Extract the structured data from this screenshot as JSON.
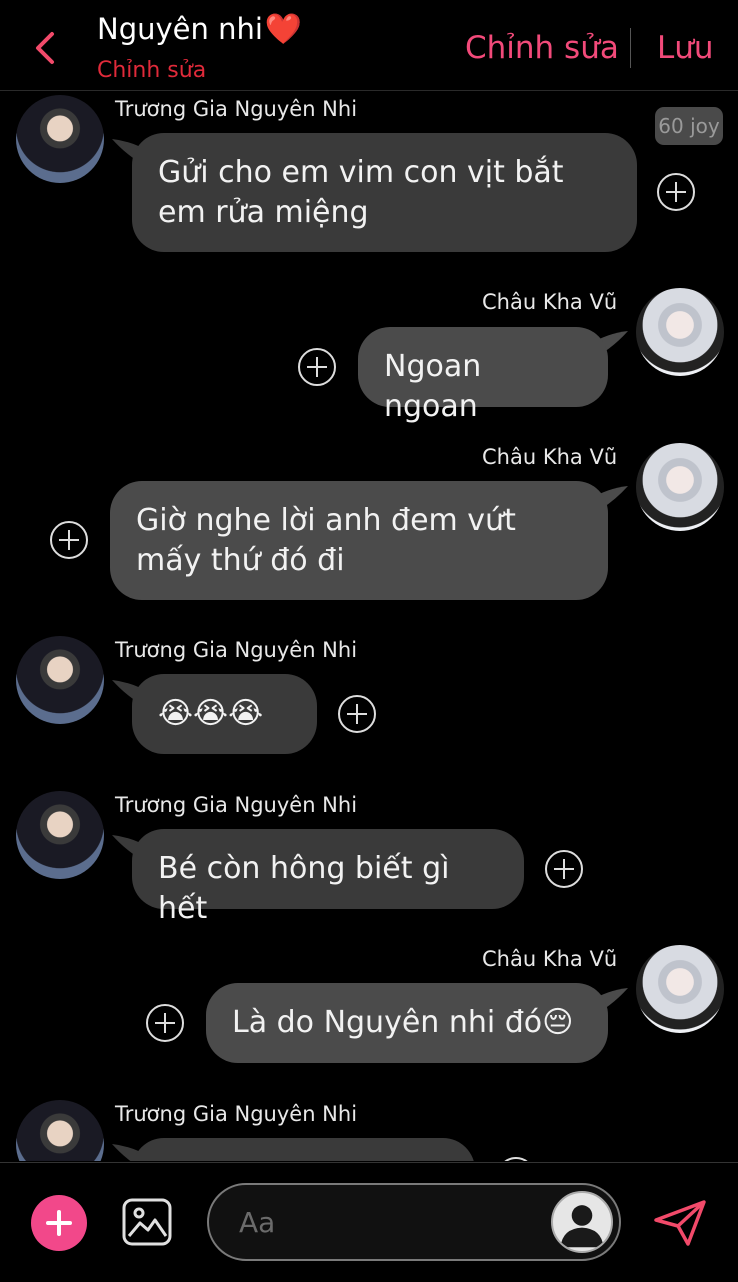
{
  "header": {
    "title": "Nguyên nhi",
    "heart": "❤️",
    "subtitle": "Chỉnh sửa",
    "edit_label": "Chỉnh sửa",
    "save_label": "Lưu"
  },
  "badge": {
    "joy": "60 joy"
  },
  "messages": [
    {
      "sender": "Trương Gia Nguyên Nhi",
      "text": "Gửi cho em vim con vịt bắt em rửa miệng"
    },
    {
      "sender": "Châu Kha Vũ",
      "text": "Ngoan ngoan"
    },
    {
      "sender": "Châu Kha Vũ",
      "text": "Giờ nghe lời anh đem vứt mấy thứ đó đi"
    },
    {
      "sender": "Trương Gia Nguyên Nhi",
      "text": "😭😭😭"
    },
    {
      "sender": "Trương Gia Nguyên Nhi",
      "text": "Bé còn hông biết gì hết"
    },
    {
      "sender": "Châu Kha Vũ",
      "text": "Là do Nguyên nhi đó😔"
    },
    {
      "sender": "Trương Gia Nguyên Nhi",
      "text": ""
    }
  ],
  "composer": {
    "placeholder": "Aa"
  },
  "colors": {
    "accent": "#f2488a",
    "background": "#000000",
    "bubble": "#3a3a3a",
    "subtitle": "#e02a3a"
  }
}
